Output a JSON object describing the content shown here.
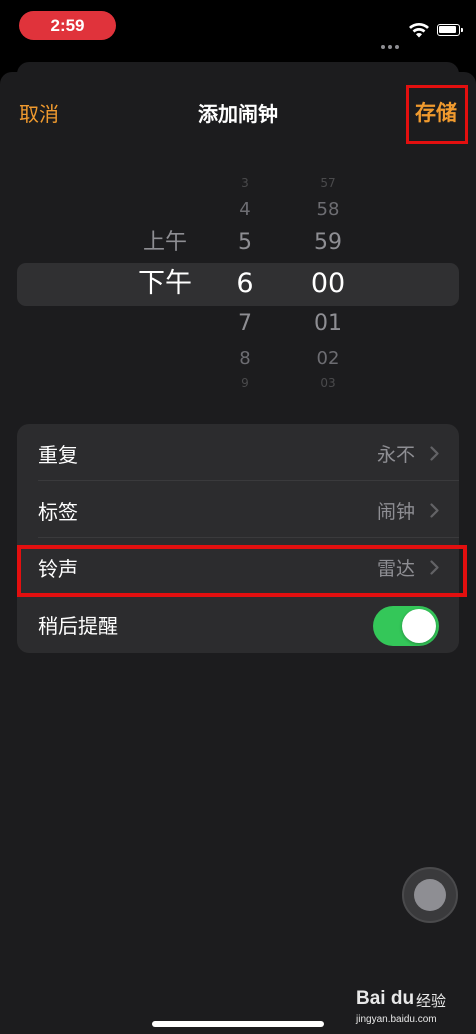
{
  "status_bar": {
    "time": "2:59",
    "icons": [
      "cellular-signal-icon",
      "wifi-icon",
      "battery-icon"
    ]
  },
  "nav": {
    "cancel_label": "取消",
    "title": "添加闹钟",
    "save_label": "存储"
  },
  "picker": {
    "ampm": {
      "items": [
        "上午",
        "下午"
      ],
      "selected": "下午"
    },
    "hours": [
      "3",
      "4",
      "5",
      "6",
      "7",
      "8",
      "9"
    ],
    "hour_selected": "6",
    "minutes": [
      "57",
      "58",
      "59",
      "00",
      "01",
      "02",
      "03"
    ],
    "minute_selected": "00"
  },
  "settings": [
    {
      "label": "重复",
      "value": "永不"
    },
    {
      "label": "标签",
      "value": "闹钟"
    },
    {
      "label": "铃声",
      "value": "雷达"
    },
    {
      "label": "稍后提醒",
      "toggle_on": true
    }
  ],
  "watermark": {
    "brand": "Bai du",
    "name": "经验",
    "url": "jingyan.baidu.com"
  },
  "colors": {
    "accent": "#f09a2e",
    "toggle_on": "#34c759",
    "highlight": "#e30f0f",
    "time_pill": "#e0333b"
  }
}
